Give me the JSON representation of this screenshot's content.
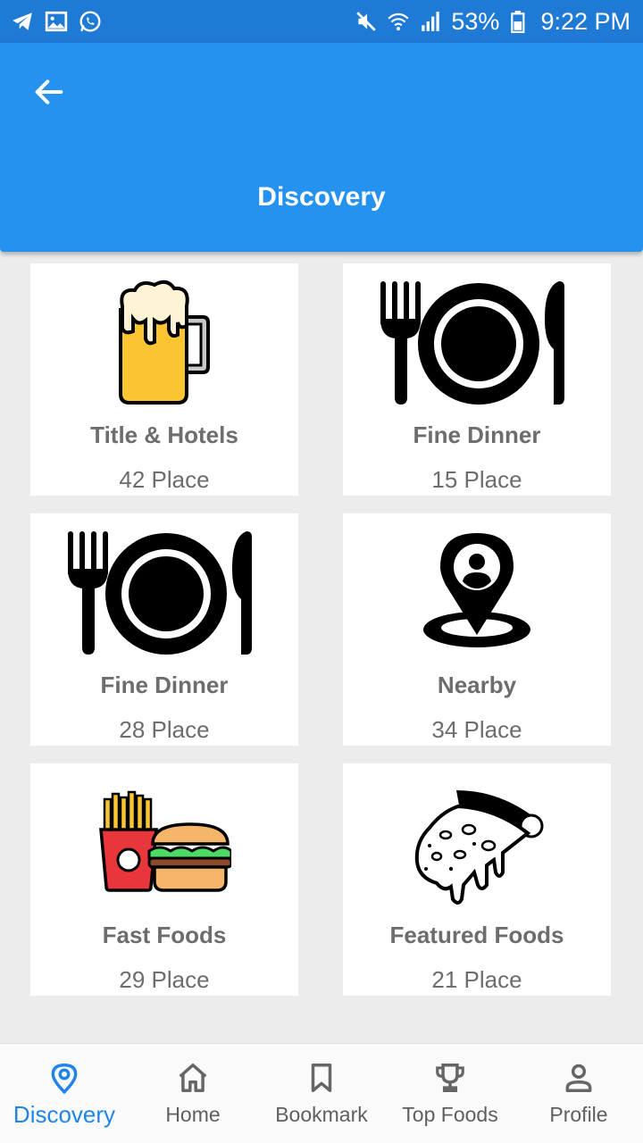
{
  "status_bar": {
    "battery": "53%",
    "time": "9:22 PM",
    "icons_left": [
      "telegram-icon",
      "gallery-icon",
      "whatsapp-icon"
    ],
    "icons_right": [
      "mute-icon",
      "wifi-icon",
      "signal-icon",
      "battery-icon"
    ]
  },
  "app_bar": {
    "title": "Discovery",
    "back_icon": "arrow-left-icon",
    "color": "#2592f0"
  },
  "categories": [
    {
      "title": "Title & Hotels",
      "count": "42 Place",
      "icon": "beer-mug-icon"
    },
    {
      "title": "Fine Dinner",
      "count": "15 Place",
      "icon": "plate-cutlery-icon"
    },
    {
      "title": "Fine Dinner",
      "count": "28 Place",
      "icon": "plate-cutlery-icon"
    },
    {
      "title": "Nearby",
      "count": "34 Place",
      "icon": "location-pin-person-icon"
    },
    {
      "title": "Fast Foods",
      "count": "29 Place",
      "icon": "fries-burger-icon"
    },
    {
      "title": "Featured Foods",
      "count": "21 Place",
      "icon": "pizza-slice-icon"
    }
  ],
  "bottom_nav": {
    "items": [
      {
        "label": "Discovery",
        "icon": "location-pin-icon",
        "active": true
      },
      {
        "label": "Home",
        "icon": "home-icon",
        "active": false
      },
      {
        "label": "Bookmark",
        "icon": "bookmark-icon",
        "active": false
      },
      {
        "label": "Top Foods",
        "icon": "trophy-icon",
        "active": false
      },
      {
        "label": "Profile",
        "icon": "person-icon",
        "active": false
      }
    ],
    "active_color": "#1f86e9"
  }
}
